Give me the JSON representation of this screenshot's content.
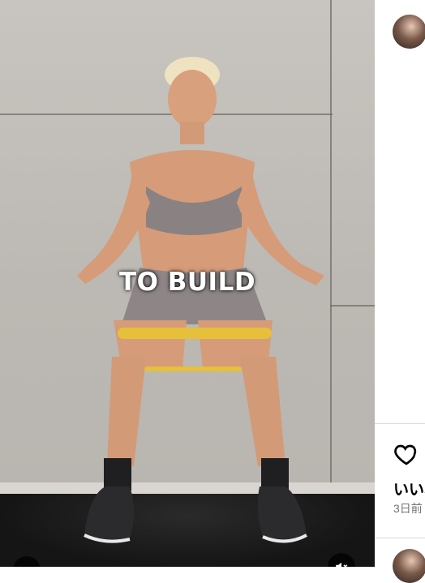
{
  "post": {
    "caption_text": "TO BUILD",
    "likes_label": "いいね",
    "date_label": "3日前"
  },
  "icons": {
    "heart": "heart-outline-icon",
    "mute": "speaker-muted-icon"
  },
  "colors": {
    "separator": "#dbdbdb",
    "date_text": "#737373",
    "band": "#e6c03a"
  }
}
